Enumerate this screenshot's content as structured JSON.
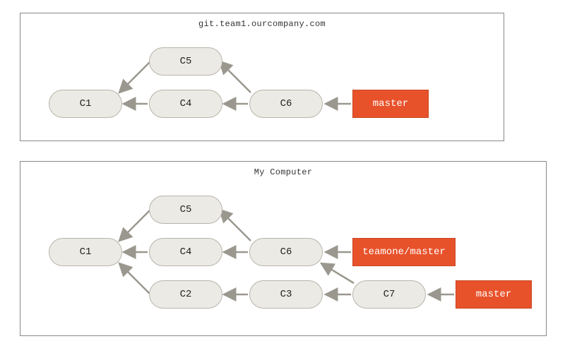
{
  "panels": {
    "remote": {
      "title": "git.team1.ourcompany.com"
    },
    "local": {
      "title": "My Computer"
    }
  },
  "commits": {
    "c1": "C1",
    "c2": "C2",
    "c3": "C3",
    "c4": "C4",
    "c5": "C5",
    "c6": "C6",
    "c7": "C7"
  },
  "refs": {
    "remote_master": "master",
    "teamone_master": "teamone/master",
    "local_master": "master"
  },
  "colors": {
    "commit_bg": "#eceae4",
    "commit_border": "#b7b4ab",
    "ref_bg": "#e8522b",
    "ref_border": "#c74721",
    "arrow": "#9a978e",
    "panel_border": "#888888"
  }
}
